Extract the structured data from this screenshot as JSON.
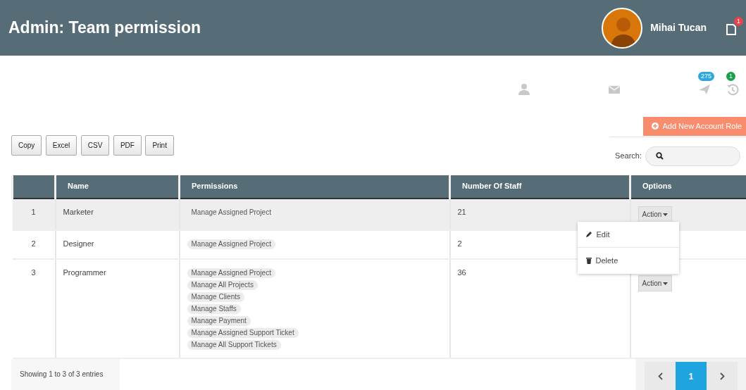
{
  "header": {
    "title": "Admin: Team permission",
    "user_name": "Mihai Tucan",
    "notification_badge": "1"
  },
  "toolbar_icons": [
    {
      "kind": "user"
    },
    {
      "kind": "mail"
    },
    {
      "kind": "plane",
      "badge": "275",
      "color": "#2ea6e0"
    },
    {
      "kind": "history",
      "badge": "1",
      "color": "#1aa04a"
    }
  ],
  "add_button": "Add New Account Role",
  "export_buttons": [
    "Copy",
    "Excel",
    "CSV",
    "PDF",
    "Print"
  ],
  "search": {
    "label": "Search:"
  },
  "table": {
    "columns": [
      "Name",
      "Permissions",
      "Number Of Staff",
      "Options"
    ],
    "rows": [
      {
        "index": "1",
        "name": "Marketer",
        "permissions": [
          "Manage Assigned Project"
        ],
        "staff": "21",
        "action": "Action",
        "hovered": true,
        "menu_open": true
      },
      {
        "index": "2",
        "name": "Designer",
        "permissions": [
          "Manage Assigned Project"
        ],
        "staff": "2",
        "hovered": false,
        "menu_open": false
      },
      {
        "index": "3",
        "name": "Programmer",
        "permissions": [
          "Manage Assigned Project",
          "Manage All Projects",
          "Manage Clients",
          "Manage Staffs",
          "Manage Payment",
          "Manage Assigned Support Ticket",
          "Manage All Support Tickets"
        ],
        "staff": "36",
        "action": "Action",
        "hovered": false,
        "menu_open": false
      }
    ]
  },
  "action_menu": [
    {
      "kind": "edit",
      "label": "Edit"
    },
    {
      "kind": "delete",
      "label": "Delete"
    }
  ],
  "footer": {
    "info": "Showing 1 to 3 of 3 entries",
    "pages": [
      {
        "label": "1",
        "selected": true
      }
    ]
  }
}
